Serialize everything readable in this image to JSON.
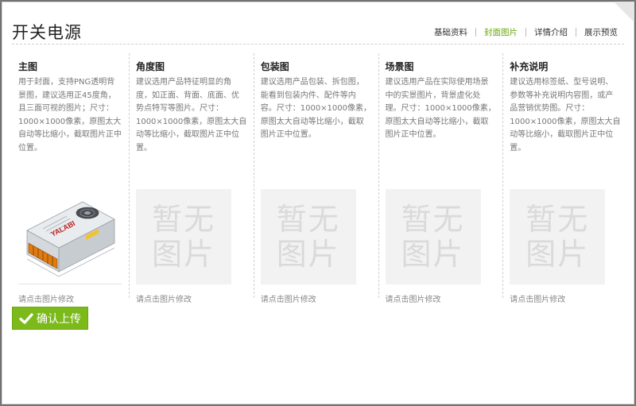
{
  "dialog": {
    "title": "开关电源"
  },
  "tabs": [
    {
      "label": "基础资料",
      "active": false
    },
    {
      "label": "封面图片",
      "active": true
    },
    {
      "label": "详情介绍",
      "active": false
    },
    {
      "label": "展示预览",
      "active": false
    }
  ],
  "columns": [
    {
      "title": "主图",
      "desc": "用于封面，支持PNG透明背景图，建议选用正45度角，且三面可视的图片；尺寸：1000×1000像素，原图太大自动等比缩小，截取图片正中位置。",
      "hint": "请点击图片修改",
      "product_brand": "YALABI"
    },
    {
      "title": "角度图",
      "desc": "建议选用产品特征明显的角度，如正面、背面、底面、优势点特写等图片。尺寸：1000×1000像素，原图太大自动等比缩小，截取图片正中位置。",
      "hint": "请点击图片修改",
      "placeholder": [
        "暂无",
        "图片"
      ]
    },
    {
      "title": "包装图",
      "desc": "建议选用产品包装、拆包图，能看到包装内件、配件等内容。尺寸：1000×1000像素，原图太大自动等比缩小，截取图片正中位置。",
      "hint": "请点击图片修改",
      "placeholder": [
        "暂无",
        "图片"
      ]
    },
    {
      "title": "场景图",
      "desc": "建议选用产品在实际使用场景中的实景图片，背景虚化处理。尺寸：1000×1000像素，原图太大自动等比缩小，截取图片正中位置。",
      "hint": "请点击图片修改",
      "placeholder": [
        "暂无",
        "图片"
      ]
    },
    {
      "title": "补充说明",
      "desc": "建议选用标签纸、型号说明、参数等补充说明内容图，或产品营销优势图。尺寸：1000×1000像素，原图太大自动等比缩小，截取图片正中位置。",
      "hint": "请点击图片修改",
      "placeholder": [
        "暂无",
        "图片"
      ]
    }
  ],
  "confirm": {
    "label": "确认上传"
  },
  "colors": {
    "accent": "#7cba1c",
    "active_tab": "#6aa80f"
  },
  "icons": {
    "confirm": "check-icon"
  }
}
